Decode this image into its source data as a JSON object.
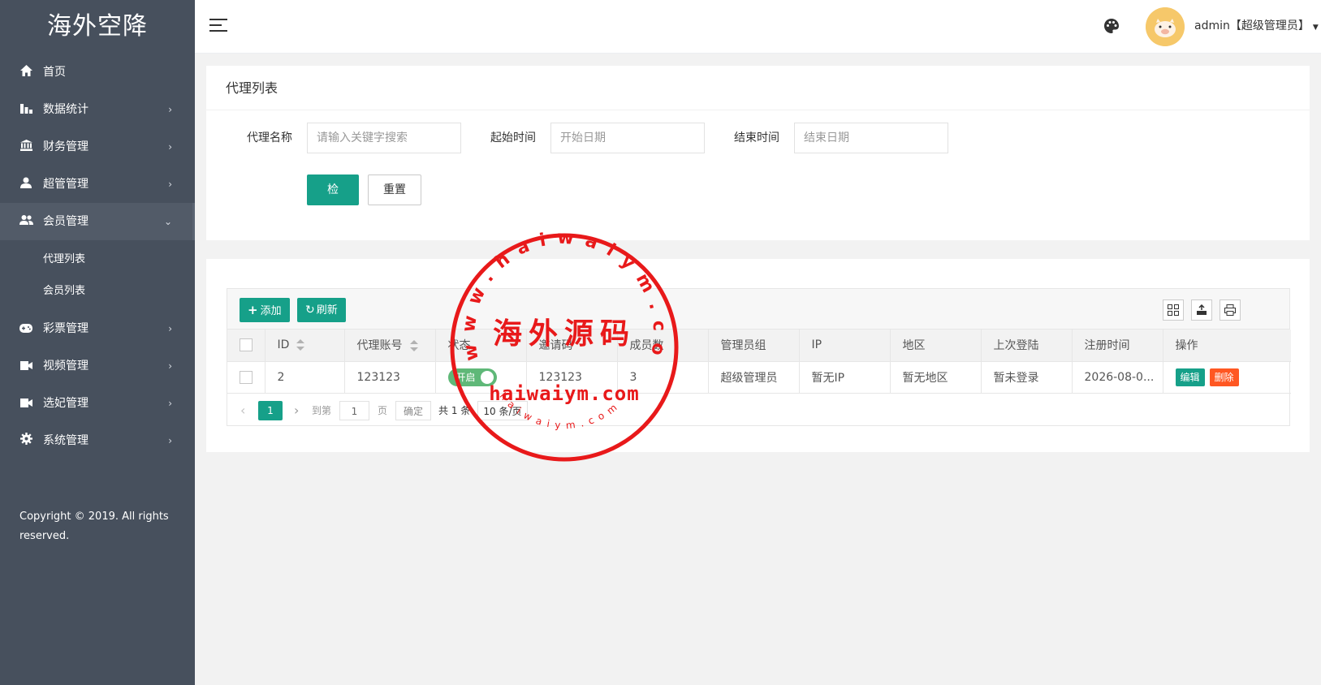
{
  "app": {
    "title": "海外空降"
  },
  "sidebar": {
    "items": [
      {
        "label": "首页",
        "icon": "home-icon",
        "has_arrow": false
      },
      {
        "label": "数据统计",
        "icon": "bar-chart-icon",
        "has_arrow": true
      },
      {
        "label": "财务管理",
        "icon": "bank-icon",
        "has_arrow": true
      },
      {
        "label": "超管管理",
        "icon": "user-icon",
        "has_arrow": true
      },
      {
        "label": "会员管理",
        "icon": "users-icon",
        "has_arrow": true,
        "open": true
      }
    ],
    "sub_items": [
      "代理列表",
      "会员列表"
    ],
    "items_after": [
      {
        "label": "彩票管理",
        "icon": "gamepad-icon"
      },
      {
        "label": "视频管理",
        "icon": "video-icon"
      },
      {
        "label": "选妃管理",
        "icon": "video-icon"
      },
      {
        "label": "系统管理",
        "icon": "gear-icon"
      }
    ],
    "copyright": "Copyright © 2019. All rights reserved."
  },
  "header": {
    "user": "admin【超级管理员】"
  },
  "search": {
    "card_title": "代理列表",
    "name_label": "代理名称",
    "name_placeholder": "请输入关键字搜索",
    "start_label": "起始时间",
    "start_placeholder": "开始日期",
    "end_label": "结束时间",
    "end_placeholder": "结束日期",
    "search_button": "检索",
    "reset_button": "重置"
  },
  "toolbar": {
    "add_label": "添加",
    "refresh_label": "刷新"
  },
  "table": {
    "columns": [
      "ID",
      "代理账号",
      "状态",
      "邀请码",
      "成员数",
      "管理员组",
      "IP",
      "地区",
      "上次登陆",
      "注册时间",
      "操作"
    ],
    "rows": [
      {
        "id": "2",
        "account": "123123",
        "status": "开启",
        "invite": "123123",
        "members": "3",
        "group": "超级管理员",
        "ip": "暂无IP",
        "region": "暂无地区",
        "last_login": "暂未登录",
        "reg_time": "2026-08-0...",
        "edit": "编辑",
        "delete": "删除"
      }
    ]
  },
  "pager": {
    "current": "1",
    "goto_label": "到第",
    "goto_value": "1",
    "page_label": "页",
    "confirm": "确定",
    "total": "共 1 条",
    "per_page": "10 条/页"
  },
  "watermark": {
    "center_text": "海外源码",
    "domain_text": "haiwaiym.com",
    "ring_text": "www.haiwaiym.com",
    "bottom_ring_text": "haiwaiym.com"
  },
  "colors": {
    "sidebar": "#47505d",
    "accent": "#16a089",
    "danger": "#ff5722",
    "switch_on": "#5fb878",
    "stamp": "#e8191a"
  }
}
